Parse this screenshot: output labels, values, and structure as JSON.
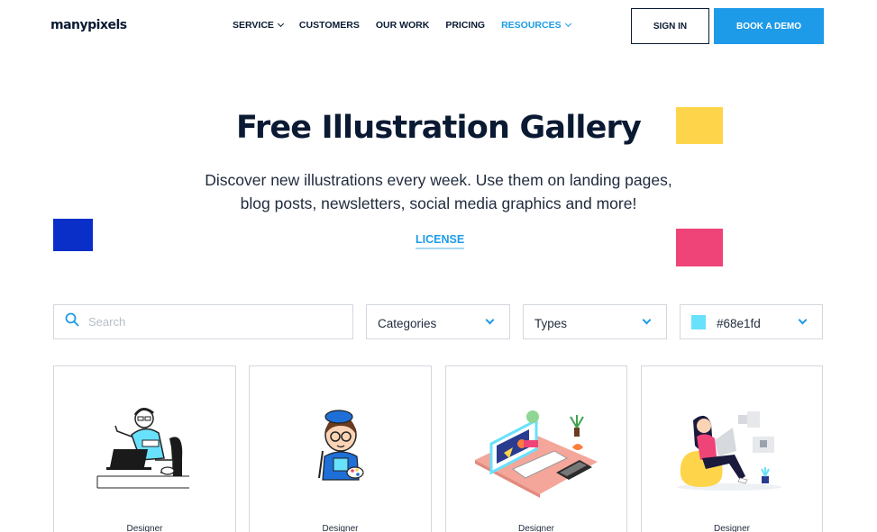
{
  "header": {
    "logo": "manypixels",
    "nav": [
      {
        "label": "SERVICE",
        "dropdown": true,
        "active": false
      },
      {
        "label": "CUSTOMERS",
        "dropdown": false,
        "active": false
      },
      {
        "label": "OUR WORK",
        "dropdown": false,
        "active": false
      },
      {
        "label": "PRICING",
        "dropdown": false,
        "active": false
      },
      {
        "label": "RESOURCES",
        "dropdown": true,
        "active": true
      }
    ],
    "signin_label": "SIGN IN",
    "demo_label": "BOOK A DEMO"
  },
  "hero": {
    "title": "Free Illustration Gallery",
    "subtitle_line1": "Discover new illustrations every week. Use them on landing pages,",
    "subtitle_line2": "blog posts, newsletters, social media graphics and more!",
    "license_label": "LICENSE"
  },
  "filters": {
    "search_placeholder": "Search",
    "search_value": "",
    "categories_label": "Categories",
    "types_label": "Types",
    "color_value": "#68e1fd"
  },
  "cards": [
    {
      "label": "Designer",
      "icon": "designer-laptop-illustration"
    },
    {
      "label": "Designer",
      "icon": "designer-painter-illustration"
    },
    {
      "label": "Designer",
      "icon": "designer-desk-isometric-illustration"
    },
    {
      "label": "Designer",
      "icon": "designer-beanbag-illustration"
    }
  ],
  "colors": {
    "accent": "#1e9be8",
    "dark": "#0b1a33",
    "deco_yellow": "#fed54a",
    "deco_blue": "#0a2fc9",
    "deco_pink": "#ee4477"
  }
}
